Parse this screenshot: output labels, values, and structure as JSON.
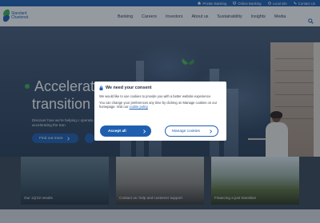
{
  "utility_bar": {
    "items": [
      {
        "label": "Private Banking",
        "icon": "private-banking-icon"
      },
      {
        "label": "Online Banking",
        "icon": "online-banking-icon"
      },
      {
        "label": "Local site",
        "icon": "globe-icon"
      },
      {
        "label": "Contact Us",
        "icon": "phone-icon"
      }
    ]
  },
  "header": {
    "logo_line1": "Standard",
    "logo_line2": "Chartered",
    "nav": [
      {
        "label": "Banking"
      },
      {
        "label": "Careers"
      },
      {
        "label": "Investors"
      },
      {
        "label": "About us"
      },
      {
        "label": "Sustainability"
      },
      {
        "label": "Insights"
      },
      {
        "label": "Media"
      }
    ]
  },
  "hero": {
    "headline_line1": "Accelerat",
    "headline_line2": "transition",
    "body": "Discover how we're helping c operate, accelerating the tran",
    "cta_label": "Find out more"
  },
  "cards": [
    {
      "label": "Our 1Q'22 results"
    },
    {
      "label": "Contact us: help and customer support"
    },
    {
      "label": "Financing a just transition"
    }
  ],
  "consent_modal": {
    "title": "We need your consent",
    "paragraph1": "We would like to use cookies to provide you with a better website experience.",
    "paragraph2_prefix": "You can change your preferences any time by clicking on Manage cookies on our homepage. Visit our",
    "policy_link": "cookie policy",
    "accept_label": "Accept all",
    "manage_label": "Manage cookies"
  },
  "colors": {
    "brand_blue": "#1f5fb0",
    "brand_green": "#38b449"
  }
}
